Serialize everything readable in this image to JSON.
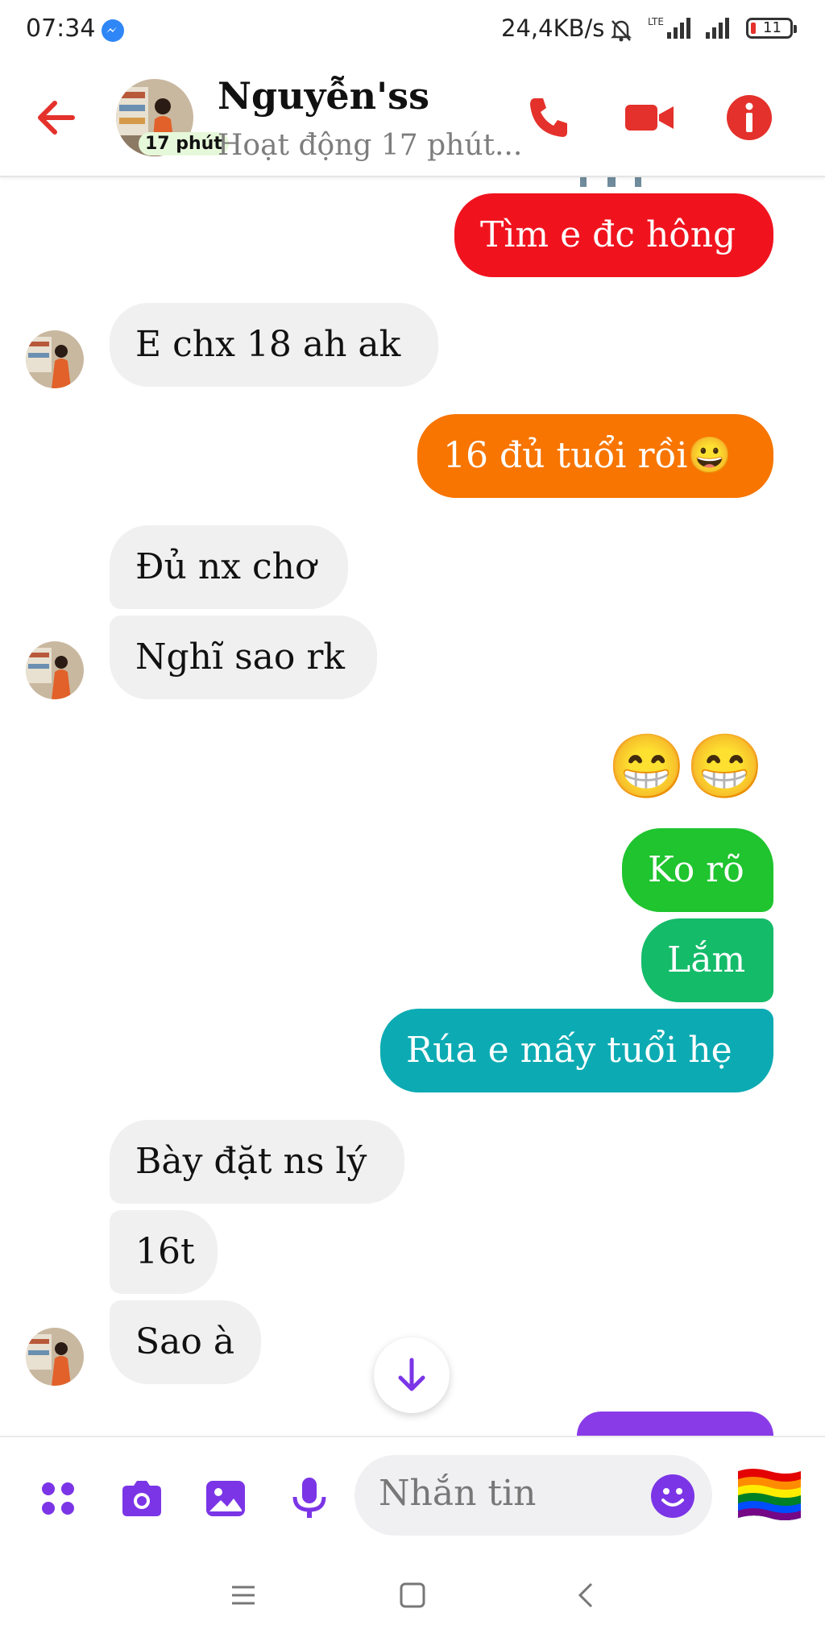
{
  "status_bar": {
    "time": "07:34",
    "speed": "24,4KB/s",
    "network": "LTE",
    "battery": "11"
  },
  "header": {
    "name": "Nguyễn'ss",
    "active_badge": "17 phút",
    "status": "Hoạt động 17 phút...",
    "accent": "#e4312b"
  },
  "messages": [
    {
      "side": "out",
      "text": "Tìm e đc hông",
      "color": "#f0131e"
    },
    {
      "side": "in",
      "text": "E chx 18 ah ak"
    },
    {
      "side": "out",
      "text": "16 đủ tuổi rồi😀",
      "color": "#f77500"
    },
    {
      "side": "in",
      "text": "Đủ nx chơ"
    },
    {
      "side": "in",
      "text": "Nghĩ sao rk"
    },
    {
      "side": "out",
      "text": "😁😁",
      "type": "emoji"
    },
    {
      "side": "out",
      "text": "Ko rõ",
      "color": "#1fc42e"
    },
    {
      "side": "out",
      "text": "Lắm",
      "color": "#14bb69"
    },
    {
      "side": "out",
      "text": "Rúa e mấy tuổi hẹ",
      "color": "#0cabb3"
    },
    {
      "side": "in",
      "text": "Bày đặt ns lý"
    },
    {
      "side": "in",
      "text": "16t"
    },
    {
      "side": "in",
      "text": "Sao à"
    }
  ],
  "composer": {
    "placeholder": "Nhắn tin",
    "accent": "#7b35e6"
  }
}
